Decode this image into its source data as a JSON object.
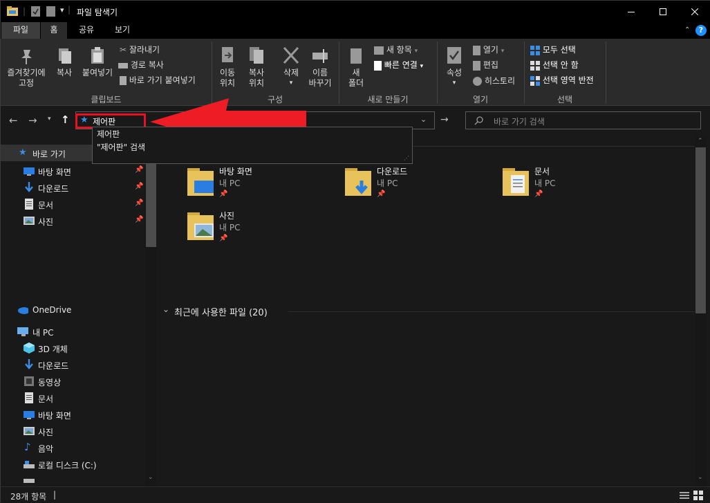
{
  "window": {
    "title": "파일 탐색기"
  },
  "tabs": [
    {
      "label": "파일"
    },
    {
      "label": "홈"
    },
    {
      "label": "공유"
    },
    {
      "label": "보기"
    }
  ],
  "ribbon": {
    "clipboard": {
      "pin": "즐겨찾기에\n고정",
      "copy": "복사",
      "paste": "붙여넣기",
      "cut": "잘라내기",
      "copy_path": "경로 복사",
      "paste_shortcut": "바로 가기 붙여넣기",
      "group": "클립보드"
    },
    "organize": {
      "move": "이동\n위치",
      "copy_to": "복사\n위치",
      "delete": "삭제",
      "rename": "이름\n바꾸기",
      "group": "구성"
    },
    "new": {
      "folder": "새\n폴더",
      "new_item": "새 항목",
      "easy_access": "빠른 연결",
      "group": "새로 만들기"
    },
    "open": {
      "properties": "속성",
      "open": "열기",
      "edit": "편집",
      "history": "히스토리",
      "group": "열기"
    },
    "select": {
      "select_all": "모두 선택",
      "select_none": "선택 안 함",
      "invert": "선택 영역 반전",
      "group": "선택"
    }
  },
  "address": {
    "value": "제어판",
    "search_placeholder": "바로 가기 검색"
  },
  "autocomplete": [
    {
      "label": "제어판"
    },
    {
      "label": "\"제어판\" 검색"
    }
  ],
  "sidebar": {
    "quick_access": "바로 가기",
    "quick_items": [
      {
        "label": "바탕 화면"
      },
      {
        "label": "다운로드"
      },
      {
        "label": "문서"
      },
      {
        "label": "사진"
      }
    ],
    "onedrive": "OneDrive",
    "this_pc": "내 PC",
    "pc_items": [
      {
        "label": "3D 개체"
      },
      {
        "label": "다운로드"
      },
      {
        "label": "동영상"
      },
      {
        "label": "문서"
      },
      {
        "label": "바탕 화면"
      },
      {
        "label": "사진"
      },
      {
        "label": "음악"
      },
      {
        "label": "로컬 디스크 (C:)"
      }
    ]
  },
  "main": {
    "folders": [
      {
        "name": "바탕 화면",
        "loc": "내 PC"
      },
      {
        "name": "다운로드",
        "loc": "내 PC"
      },
      {
        "name": "문서",
        "loc": "내 PC"
      },
      {
        "name": "사진",
        "loc": "내 PC"
      }
    ],
    "recent_header": "최근에 사용한 파일 (20)"
  },
  "status": {
    "count": "28개 항목"
  },
  "colors": {
    "accent": "#1e90ff",
    "highlight": "#e81123",
    "arrow": "#ee1c25",
    "folder": "#e8c25a"
  }
}
